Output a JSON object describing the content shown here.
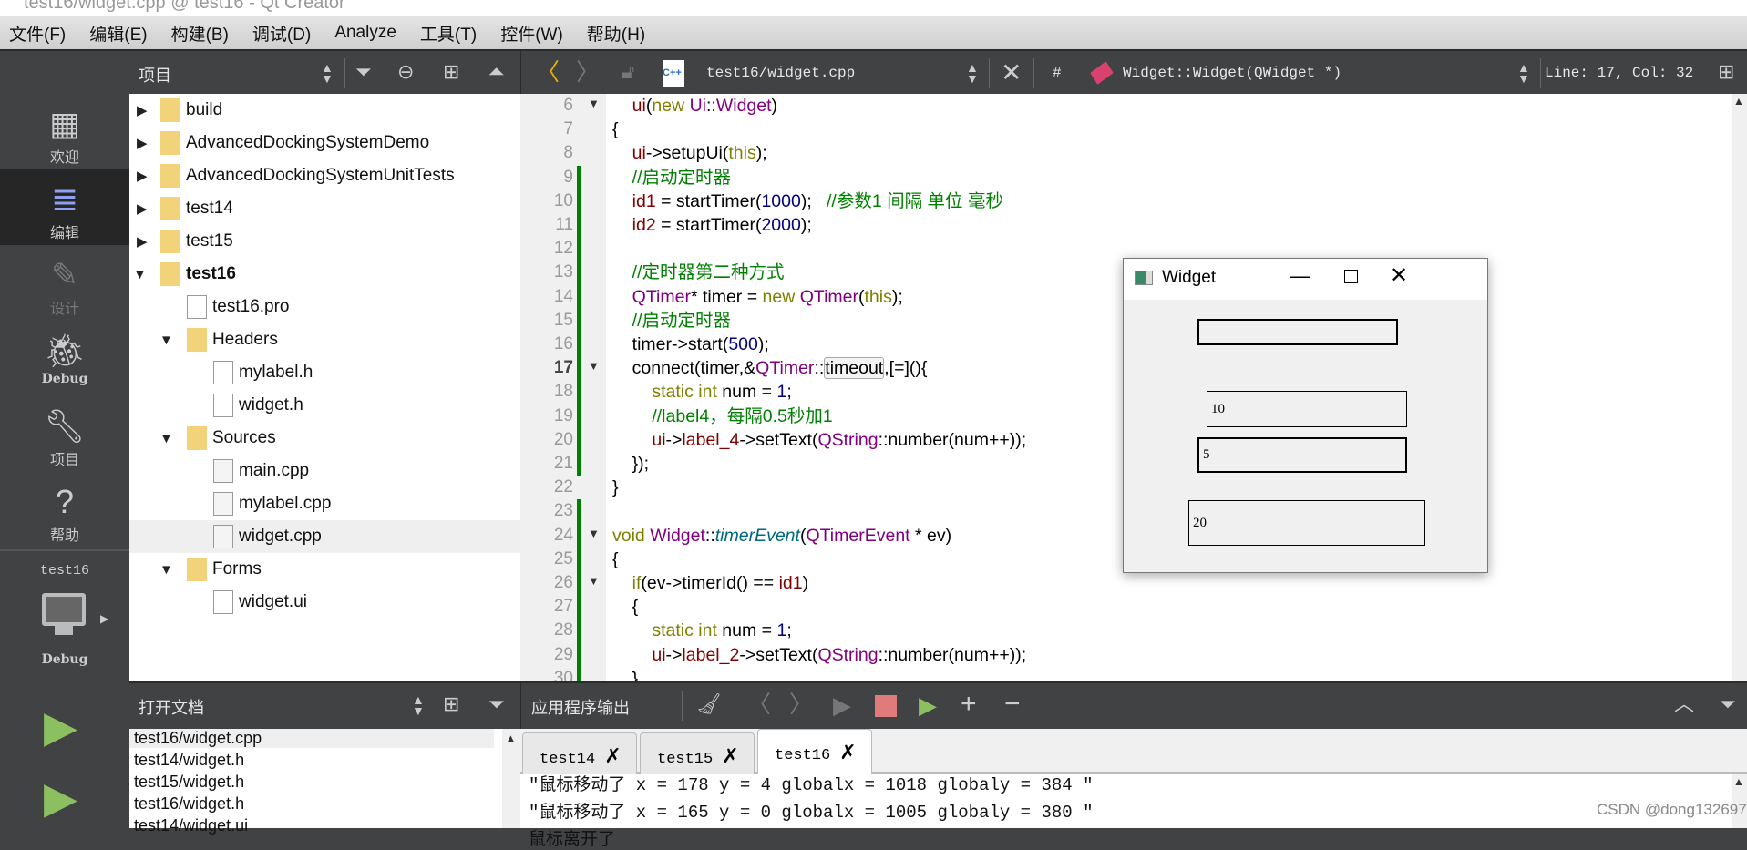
{
  "window_title": "test16/widget.cpp @ test16 - Qt Creator",
  "menu": [
    "文件(F)",
    "编辑(E)",
    "构建(B)",
    "调试(D)",
    "Analyze",
    "工具(T)",
    "控件(W)",
    "帮助(H)"
  ],
  "project_pane": {
    "title": "项目"
  },
  "editor_toolbar": {
    "file": "test16/widget.cpp",
    "hash": "#",
    "symbol": "Widget::Widget(QWidget *)",
    "position": "Line: 17, Col: 32"
  },
  "modes": [
    {
      "label": "欢迎",
      "icon": "grid-icon"
    },
    {
      "label": "编辑",
      "icon": "edit-icon",
      "selected": true
    },
    {
      "label": "设计",
      "icon": "pencil-icon",
      "disabled": true
    },
    {
      "label": "Debug",
      "icon": "bug-icon"
    },
    {
      "label": "项目",
      "icon": "wrench-icon"
    },
    {
      "label": "帮助",
      "icon": "help-icon"
    }
  ],
  "kit": {
    "project": "test16",
    "build": "Debug"
  },
  "tree": [
    {
      "label": "build",
      "level": 0,
      "fold": "closed",
      "icon": "qt-folder"
    },
    {
      "label": "AdvancedDockingSystemDemo",
      "level": 0,
      "fold": "closed",
      "icon": "qt-folder"
    },
    {
      "label": "AdvancedDockingSystemUnitTests",
      "level": 0,
      "fold": "closed",
      "icon": "qt-folder"
    },
    {
      "label": "test14",
      "level": 0,
      "fold": "closed",
      "icon": "qt-folder"
    },
    {
      "label": "test15",
      "level": 0,
      "fold": "closed",
      "icon": "qt-folder"
    },
    {
      "label": "test16",
      "level": 0,
      "fold": "open",
      "icon": "qt-folder",
      "bold": true
    },
    {
      "label": "test16.pro",
      "level": 1,
      "icon": "pro-file"
    },
    {
      "label": "Headers",
      "level": 1,
      "fold": "open",
      "icon": "h-folder"
    },
    {
      "label": "mylabel.h",
      "level": 2,
      "icon": "h-file"
    },
    {
      "label": "widget.h",
      "level": 2,
      "icon": "h-file"
    },
    {
      "label": "Sources",
      "level": 1,
      "fold": "open",
      "icon": "cpp-folder"
    },
    {
      "label": "main.cpp",
      "level": 2,
      "icon": "cpp-file"
    },
    {
      "label": "mylabel.cpp",
      "level": 2,
      "icon": "cpp-file"
    },
    {
      "label": "widget.cpp",
      "level": 2,
      "icon": "cpp-file",
      "selected": true
    },
    {
      "label": "Forms",
      "level": 1,
      "fold": "open",
      "icon": "ui-folder"
    },
    {
      "label": "widget.ui",
      "level": 2,
      "icon": "ui-file"
    }
  ],
  "code": {
    "current_line": 17,
    "first_line": 6,
    "lines": [
      [
        [
          "    "
        ],
        [
          "ui",
          "mb"
        ],
        [
          "("
        ],
        [
          "new",
          "kw"
        ],
        [
          " "
        ],
        [
          "Ui",
          "ty"
        ],
        [
          "::"
        ],
        [
          "Widget",
          "ty"
        ],
        [
          ")"
        ]
      ],
      [
        [
          "{"
        ]
      ],
      [
        [
          "    "
        ],
        [
          "ui",
          "mb"
        ],
        [
          "->setupUi("
        ],
        [
          "this",
          "kw"
        ],
        [
          ");"
        ]
      ],
      [
        [
          "    "
        ],
        [
          "//启动定时器",
          "cm"
        ]
      ],
      [
        [
          "    "
        ],
        [
          "id1",
          "mb"
        ],
        [
          " = startTimer("
        ],
        [
          "1000",
          "nu"
        ],
        [
          ");   "
        ],
        [
          "//参数1 间隔 单位 毫秒",
          "cm"
        ]
      ],
      [
        [
          "    "
        ],
        [
          "id2",
          "mb"
        ],
        [
          " = startTimer("
        ],
        [
          "2000",
          "nu"
        ],
        [
          ");"
        ]
      ],
      [
        [
          ""
        ]
      ],
      [
        [
          "    "
        ],
        [
          "//定时器第二种方式",
          "cm"
        ]
      ],
      [
        [
          "    "
        ],
        [
          "QTimer",
          "ty"
        ],
        [
          "* timer = "
        ],
        [
          "new",
          "kw"
        ],
        [
          " "
        ],
        [
          "QTimer",
          "ty"
        ],
        [
          "("
        ],
        [
          "this",
          "kw"
        ],
        [
          ");"
        ]
      ],
      [
        [
          "    "
        ],
        [
          "//启动定时器",
          "cm"
        ]
      ],
      [
        [
          "    timer->start("
        ],
        [
          "500",
          "nu"
        ],
        [
          ");"
        ]
      ],
      [
        [
          "    connect(timer,&"
        ],
        [
          "QTimer",
          "ty"
        ],
        [
          "::"
        ],
        [
          "timeout",
          "hl"
        ],
        [
          ",[=](){"
        ]
      ],
      [
        [
          "        "
        ],
        [
          "static",
          "kw"
        ],
        [
          " "
        ],
        [
          "int",
          "kw"
        ],
        [
          " num = "
        ],
        [
          "1",
          "nu"
        ],
        [
          ";"
        ]
      ],
      [
        [
          "        "
        ],
        [
          "//label4，每隔0.5秒加1",
          "cm"
        ]
      ],
      [
        [
          "        "
        ],
        [
          "ui",
          "mb"
        ],
        [
          "->"
        ],
        [
          "label_4",
          "mb"
        ],
        [
          "->setText("
        ],
        [
          "QString",
          "ty"
        ],
        [
          "::number(num++));"
        ]
      ],
      [
        [
          "    });"
        ]
      ],
      [
        [
          "}"
        ]
      ],
      [
        [
          ""
        ]
      ],
      [
        [
          "void",
          "kw"
        ],
        [
          " "
        ],
        [
          "Widget",
          "ty"
        ],
        [
          "::"
        ],
        [
          "timerEvent",
          "it"
        ],
        [
          "("
        ],
        [
          "QTimerEvent",
          "ty"
        ],
        [
          " * ev)"
        ]
      ],
      [
        [
          "{"
        ]
      ],
      [
        [
          "    "
        ],
        [
          "if",
          "kw"
        ],
        [
          "(ev->timerId() == "
        ],
        [
          "id1",
          "mb"
        ],
        [
          ")"
        ]
      ],
      [
        [
          "    {"
        ]
      ],
      [
        [
          "        "
        ],
        [
          "static",
          "kw"
        ],
        [
          " "
        ],
        [
          "int",
          "kw"
        ],
        [
          " num = "
        ],
        [
          "1",
          "nu"
        ],
        [
          ";"
        ]
      ],
      [
        [
          "        "
        ],
        [
          "ui",
          "mb"
        ],
        [
          "->"
        ],
        [
          "label_2",
          "mb"
        ],
        [
          "->setText("
        ],
        [
          "QString",
          "ty"
        ],
        [
          "::number(num++));"
        ]
      ],
      [
        [
          "    }"
        ]
      ]
    ],
    "folds": [
      6,
      17,
      24,
      26
    ],
    "changed_ranges": [
      [
        9,
        21
      ],
      [
        23,
        30
      ]
    ]
  },
  "open_docs": {
    "title": "打开文档",
    "items": [
      "test16/widget.cpp",
      "test14/widget.h",
      "test15/widget.h",
      "test16/widget.h",
      "test14/widget.ui"
    ]
  },
  "output": {
    "title": "应用程序输出",
    "tabs": [
      "test14",
      "test15",
      "test16"
    ],
    "active_tab": "test16",
    "lines": [
      "\"鼠标移动了 x = 178 y = 4 globalx = 1018 globaly = 384 \"",
      "\"鼠标移动了 x = 165 y = 0 globalx = 1005 globaly = 380 \"",
      "鼠标离开了"
    ]
  },
  "widget_window": {
    "title": "Widget",
    "labels": [
      "",
      "10",
      "5",
      "20"
    ]
  },
  "watermark": "CSDN @dong132697",
  "colors": {
    "toolbar": "#404244",
    "change_bar": "#008000",
    "run": "#8cbf5f",
    "stop": "#e07b7b",
    "keyword": "#808000",
    "type": "#800080",
    "number": "#000080",
    "comment": "#008000"
  }
}
